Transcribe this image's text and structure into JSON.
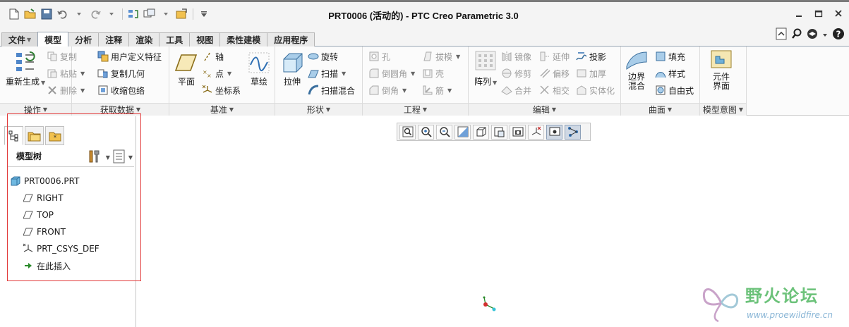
{
  "window": {
    "title": "PRT0006 (活动的) - PTC Creo Parametric 3.0"
  },
  "tabs": [
    {
      "label": "文件",
      "id": "file"
    },
    {
      "label": "模型",
      "id": "model"
    },
    {
      "label": "分析",
      "id": "analysis"
    },
    {
      "label": "注释",
      "id": "annotate"
    },
    {
      "label": "渲染",
      "id": "render"
    },
    {
      "label": "工具",
      "id": "tools"
    },
    {
      "label": "视图",
      "id": "view"
    },
    {
      "label": "柔性建模",
      "id": "flexible"
    },
    {
      "label": "应用程序",
      "id": "apps"
    }
  ],
  "ribbon": {
    "operations": {
      "label": "操作",
      "regenerate": "重新生成",
      "copy": "复制",
      "paste": "粘贴",
      "delete": "删除"
    },
    "get_data": {
      "label": "获取数据",
      "udf": "用户定义特征",
      "copy_geom": "复制几何",
      "shrinkwrap": "收缩包络"
    },
    "datum": {
      "label": "基准",
      "plane": "平面",
      "axis": "轴",
      "point": "点",
      "csys": "坐标系",
      "sketch": "草绘"
    },
    "shapes": {
      "label": "形状",
      "extrude": "拉伸",
      "revolve": "旋转",
      "sweep": "扫描",
      "swept_blend": "扫描混合"
    },
    "engineering": {
      "label": "工程",
      "hole": "孔",
      "round": "倒圆角",
      "chamfer": "倒角",
      "draft": "拔模",
      "shell": "壳",
      "rib": "筋"
    },
    "editing": {
      "label": "编辑",
      "pattern": "阵列",
      "mirror": "镜像",
      "trim": "修剪",
      "merge": "合并",
      "extend": "延伸",
      "offset": "偏移",
      "intersect": "相交",
      "project": "投影",
      "thicken": "加厚",
      "solidify": "实体化"
    },
    "surfaces": {
      "label": "曲面",
      "boundary_blend_1": "边界",
      "boundary_blend_2": "混合",
      "fill": "填充",
      "style": "样式",
      "freestyle": "自由式"
    },
    "model_intent": {
      "label": "模型意图",
      "component_1": "元件",
      "component_2": "界面"
    }
  },
  "model_tree": {
    "title": "模型树",
    "root": "PRT0006.PRT",
    "items": [
      "RIGHT",
      "TOP",
      "FRONT",
      "PRT_CSYS_DEF",
      "在此插入"
    ]
  },
  "watermark": {
    "text": "野火论坛",
    "url": "www.proewildfire.cn"
  },
  "colors": {
    "accent_blue": "#2f6fb3",
    "highlight_box": "#e23b3b",
    "insert_arrow": "#2a8a2a"
  }
}
